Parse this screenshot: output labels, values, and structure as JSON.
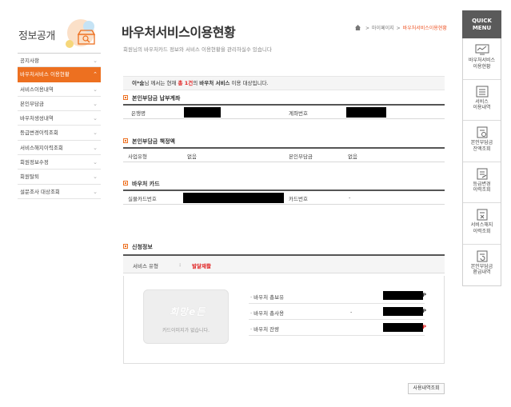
{
  "sidebar": {
    "title": "정보공개",
    "items": [
      {
        "label": "공지사항",
        "active": false
      },
      {
        "label": "바우처서비스 이용현황",
        "active": true
      },
      {
        "label": "서비스이용내역",
        "active": false
      },
      {
        "label": "본인부담금",
        "active": false
      },
      {
        "label": "바우처생성내역",
        "active": false
      },
      {
        "label": "등급변경이력조회",
        "active": false
      },
      {
        "label": "서비스해지이력조회",
        "active": false
      },
      {
        "label": "회원정보수정",
        "active": false
      },
      {
        "label": "회원탈퇴",
        "active": false
      },
      {
        "label": "설문조사 대상조회",
        "active": false
      }
    ]
  },
  "header": {
    "title": "바우처서비스이용현황",
    "subtitle": "회원님의 바우처카드 정보와 서비스 이용현황을 관리하실수 있습니다",
    "breadcrumb": [
      "마이페이지",
      "바우처서비스이용현황"
    ]
  },
  "notice": {
    "name": "이*숨",
    "text1": "님 께서는 현재",
    "count": "총 1건",
    "text2": "의",
    "service": "바우처 서비스",
    "text3": "이용 대상입니다."
  },
  "payment_account": {
    "title": "본인부담금 납부계좌",
    "bank_label": "은행명",
    "account_label": "계좌번호"
  },
  "payment_liability": {
    "title": "본인부담금 책정액",
    "business_type_label": "사업유형",
    "business_type_value": "없음",
    "copay_label": "본인부담금",
    "copay_value": "없음"
  },
  "voucher_card": {
    "title": "바우처 카드",
    "actual_card_label": "실물카드번호",
    "card_label": "카드번호",
    "card_value": "-"
  },
  "application": {
    "title": "신청정보",
    "service_type_label": "서비스 유형",
    "colon": ":",
    "service_type_value": "발달재활",
    "card_logo": "희망e든",
    "card_empty_text": "카드이미지가 없습니다.",
    "rows": [
      {
        "label": "· 바우처 총보유",
        "dash": "",
        "unit": "P",
        "unit_color": "#333333"
      },
      {
        "label": "· 바우처 총사용",
        "dash": "-",
        "unit": "P",
        "unit_color": "#333333"
      },
      {
        "label": "· 바우처 잔량",
        "dash": "",
        "unit": "P",
        "unit_color": "#e02020"
      }
    ]
  },
  "buttons": {
    "history": "사용내역조회"
  },
  "quick_menu": {
    "title_line1": "QUICK",
    "title_line2": "MENU",
    "items": [
      {
        "line1": "바우처서비스",
        "line2": "이용현황",
        "icon": "chart-icon"
      },
      {
        "line1": "서비스",
        "line2": "이용내역",
        "icon": "list-icon"
      },
      {
        "line1": "본인부담금",
        "line2": "잔액조회",
        "icon": "balance-icon"
      },
      {
        "line1": "등급변경",
        "line2": "이력조회",
        "icon": "edit-doc-icon"
      },
      {
        "line1": "서비스해지",
        "line2": "이력조회",
        "icon": "cancel-doc-icon"
      },
      {
        "line1": "본인부담금",
        "line2": "환급내역",
        "icon": "refund-icon"
      }
    ]
  },
  "colors": {
    "accent": "#ed7020",
    "highlight_red": "#e02020",
    "quick_header": "#5a5a5a"
  }
}
